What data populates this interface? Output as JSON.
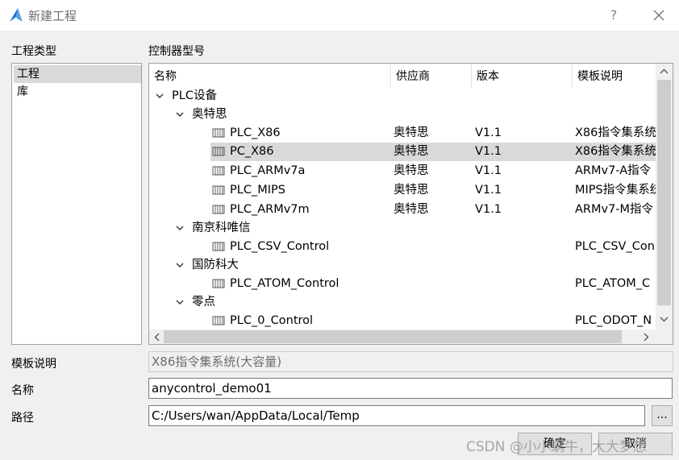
{
  "window": {
    "title": "新建工程",
    "help": "?"
  },
  "labels": {
    "project_type": "工程类型",
    "controller_model": "控制器型号",
    "template_desc": "模板说明",
    "name": "名称",
    "path": "路径"
  },
  "project_types": [
    {
      "label": "工程",
      "selected": true
    },
    {
      "label": "库",
      "selected": false
    }
  ],
  "tree": {
    "columns": [
      "名称",
      "供应商",
      "版本",
      "模板说明"
    ],
    "nodes": [
      {
        "label": "PLC设备"
      },
      {
        "label": "奥特思"
      },
      {
        "name": "PLC_X86",
        "vendor": "奥特思",
        "version": "V1.1",
        "desc": "X86指令集系统"
      },
      {
        "name": "PC_X86",
        "vendor": "奥特思",
        "version": "V1.1",
        "desc": "X86指令集系统",
        "selected": true
      },
      {
        "name": "PLC_ARMv7a",
        "vendor": "奥特思",
        "version": "V1.1",
        "desc": "ARMv7-A指令"
      },
      {
        "name": "PLC_MIPS",
        "vendor": "奥特思",
        "version": "V1.1",
        "desc": "MIPS指令集系统"
      },
      {
        "name": "PLC_ARMv7m",
        "vendor": "奥特思",
        "version": "V1.1",
        "desc": "ARMv7-M指令"
      },
      {
        "label": "南京科唯信"
      },
      {
        "name": "PLC_CSV_Control",
        "desc": "PLC_CSV_Con"
      },
      {
        "label": "国防科大"
      },
      {
        "name": "PLC_ATOM_Control",
        "desc": "PLC_ATOM_C"
      },
      {
        "label": "零点"
      },
      {
        "name": "PLC_0_Control",
        "desc": "PLC_ODOT_N"
      }
    ]
  },
  "form": {
    "template_desc_value": "X86指令集系统(大容量)",
    "name_value": "anycontrol_demo01",
    "path_value": "C:/Users/wan/AppData/Local/Temp",
    "browse_label": "..."
  },
  "buttons": {
    "ok": "确定",
    "cancel": "取消"
  },
  "watermark": "CSDN @小小蜗牛，大大梦想",
  "colors": {
    "selection": "#d9d9d9",
    "accent": "#1e73d2",
    "background": "#f0f0f0"
  },
  "icons": {
    "app": "app-logo-icon",
    "close": "close-icon",
    "expand": "chevron-down-icon",
    "item": "device-template-icon"
  }
}
